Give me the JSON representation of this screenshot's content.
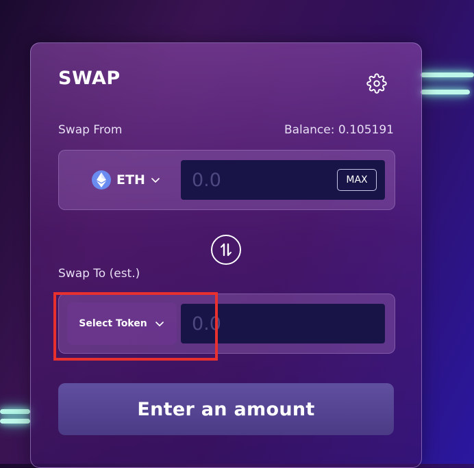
{
  "swap": {
    "title": "SWAP",
    "from_label": "Swap From",
    "balance": "Balance: 0.105191",
    "from_token": {
      "symbol": "ETH",
      "icon": "ethereum-icon"
    },
    "from_amount_placeholder": "0.0",
    "max_label": "MAX",
    "to_label": "Swap To (est.)",
    "select_token_label": "Select Token",
    "to_amount_placeholder": "0.0",
    "submit_label": "Enter an amount",
    "icons": {
      "settings": "gear-icon",
      "switch": "swap-direction-icon",
      "chevron": "chevron-down-icon"
    }
  },
  "colors": {
    "highlight": "#e8312f",
    "input_bg": "#181448",
    "accent_glow": "#bff7ea"
  }
}
